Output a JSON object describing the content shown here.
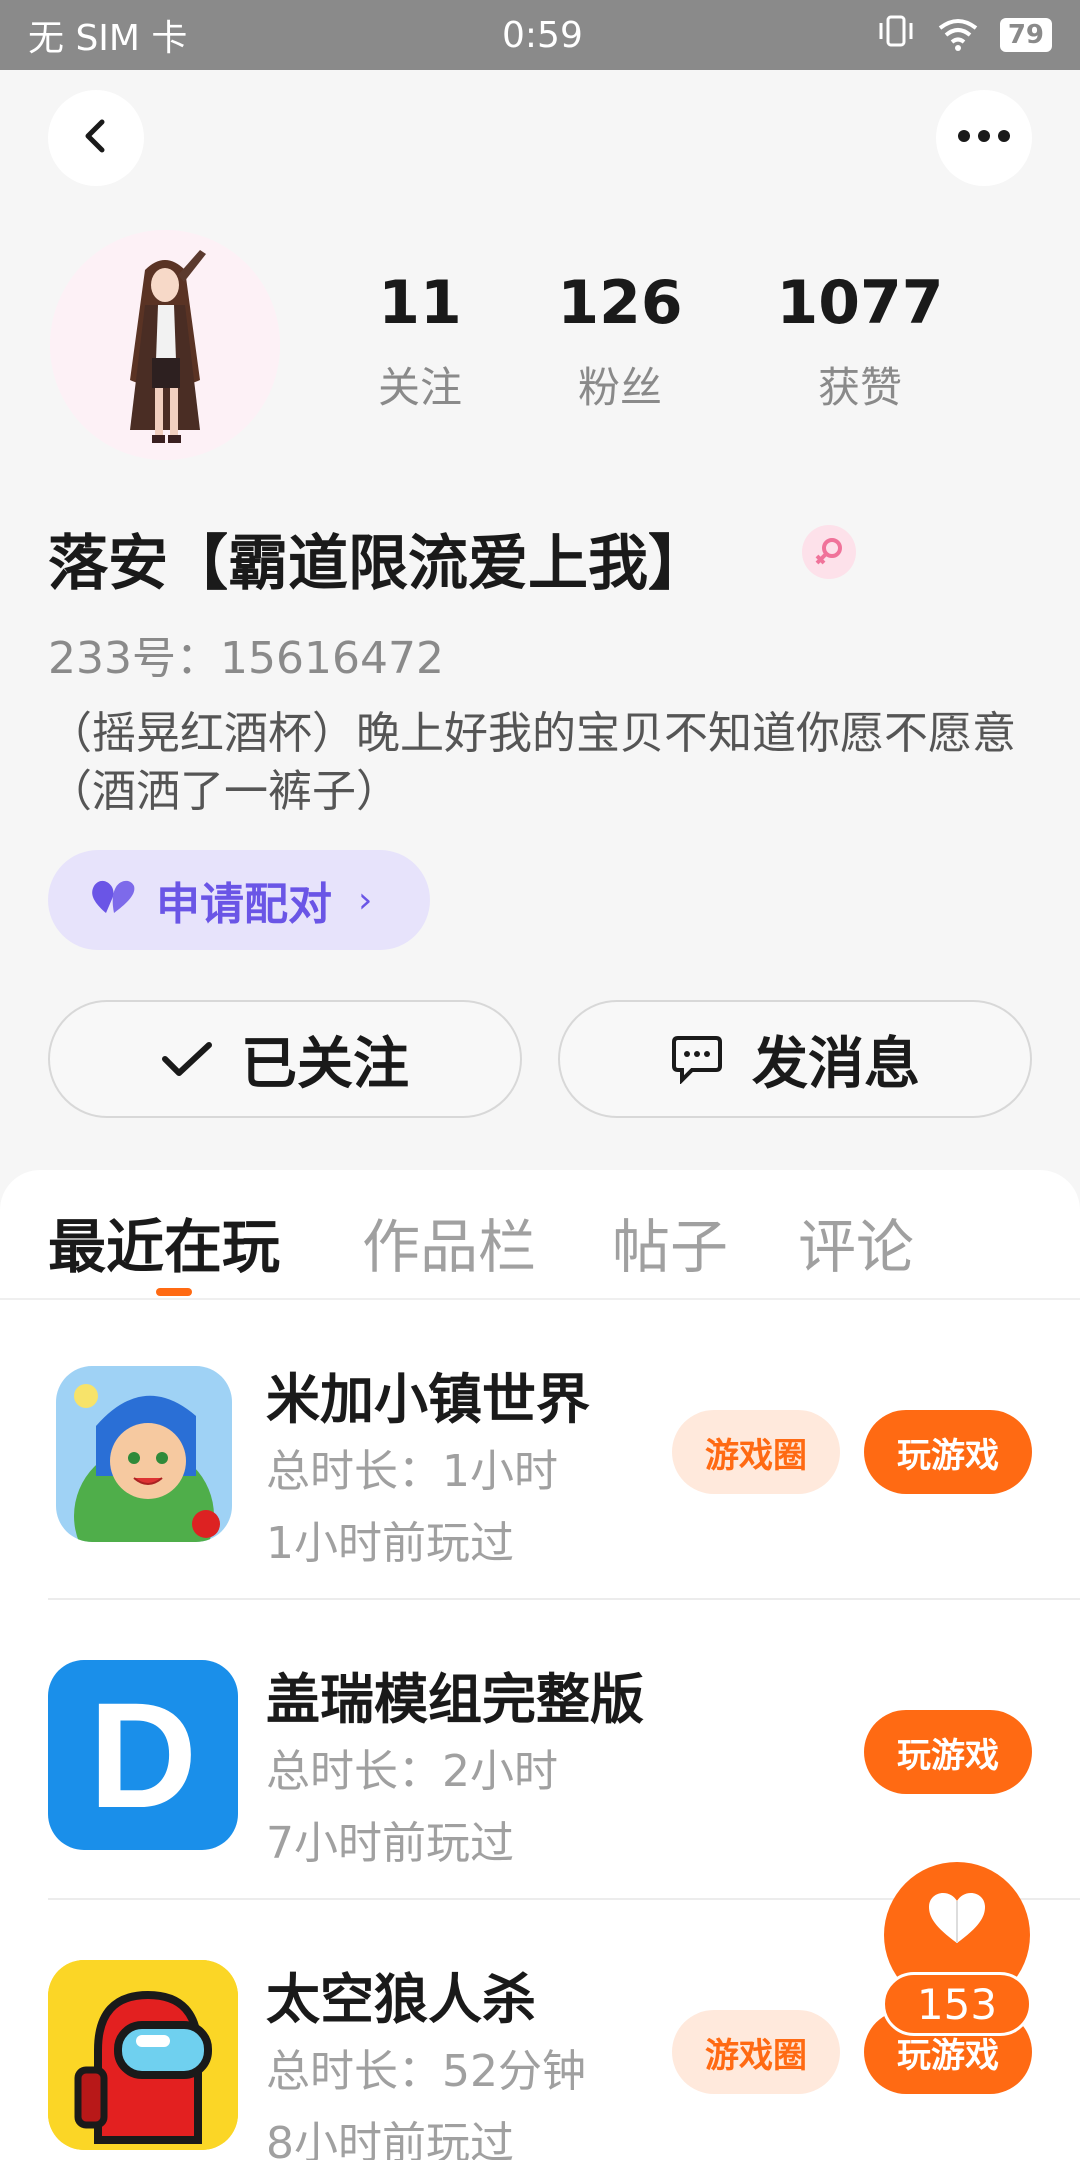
{
  "status_bar": {
    "carrier": "无 SIM 卡",
    "time": "0:59",
    "battery": "79"
  },
  "header": {
    "back_icon": "chevron-left-icon",
    "more_icon": "more-dots-icon"
  },
  "profile": {
    "stats": [
      {
        "value": "11",
        "label": "关注"
      },
      {
        "value": "126",
        "label": "粉丝"
      },
      {
        "value": "1077",
        "label": "获赞"
      }
    ],
    "nickname": "落安【霸道限流爱上我】",
    "uid": "233号：15616472",
    "bio": "（摇晃红酒杯）晚上好我的宝贝不知道你愿不愿意（酒洒了一裤子）",
    "pair_button": "申请配对",
    "follow_button": "已关注",
    "message_button": "发消息"
  },
  "tabs": [
    {
      "label": "最近在玩",
      "active": true
    },
    {
      "label": "作品栏",
      "active": false
    },
    {
      "label": "帖子",
      "active": false
    },
    {
      "label": "评论",
      "active": false
    }
  ],
  "games": [
    {
      "name": "米加小镇世界",
      "duration": "总时长：1小时",
      "last_played": "1小时前玩过",
      "circle_label": "游戏圈",
      "play_label": "玩游戏"
    },
    {
      "name": "盖瑞模组完整版",
      "duration": "总时长：2小时",
      "last_played": "7小时前玩过",
      "play_label": "玩游戏",
      "icon_letter": "D"
    },
    {
      "name": "太空狼人杀",
      "duration": "总时长：52分钟",
      "last_played": "8小时前玩过",
      "circle_label": "游戏圈",
      "play_label": "玩游戏"
    }
  ],
  "like_fab": {
    "count": "153"
  },
  "colors": {
    "accent": "#ff6a13",
    "pair": "#6a55e6"
  }
}
